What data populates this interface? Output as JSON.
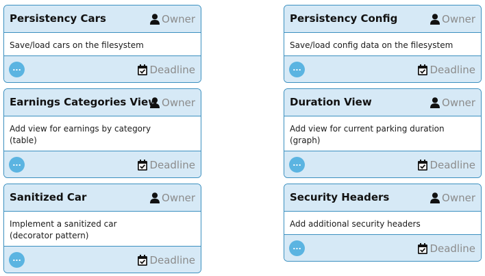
{
  "icons": {
    "owner": "user-icon",
    "deadline": "calendar-check-icon",
    "more": "ellipsis"
  },
  "colors": {
    "header_bg": "#d6e9f6",
    "border": "#3a8fbf",
    "more_button": "#5bb4e1",
    "muted_text": "#8b8b8b"
  },
  "cards": [
    {
      "title": "Persistency Cars",
      "owner": "Owner",
      "description": [
        "Save/load cars on the filesystem"
      ],
      "more": "...",
      "deadline": "Deadline"
    },
    {
      "title": "Persistency Config",
      "owner": "Owner",
      "description": [
        "Save/load config data on the filesystem"
      ],
      "more": "...",
      "deadline": "Deadline"
    },
    {
      "title": "Earnings Categories View",
      "owner": "Owner",
      "description": [
        "Add view for earnings by category",
        "(table)"
      ],
      "more": "...",
      "deadline": "Deadline"
    },
    {
      "title": "Duration View",
      "owner": "Owner",
      "description": [
        "Add view for current parking duration",
        "(graph)"
      ],
      "more": "...",
      "deadline": "Deadline"
    },
    {
      "title": "Sanitized Car",
      "owner": "Owner",
      "description": [
        "Implement a sanitized car",
        "(decorator pattern)"
      ],
      "more": "...",
      "deadline": "Deadline"
    },
    {
      "title": "Security Headers",
      "owner": "Owner",
      "description": [
        "Add additional security headers"
      ],
      "more": "...",
      "deadline": "Deadline"
    }
  ]
}
